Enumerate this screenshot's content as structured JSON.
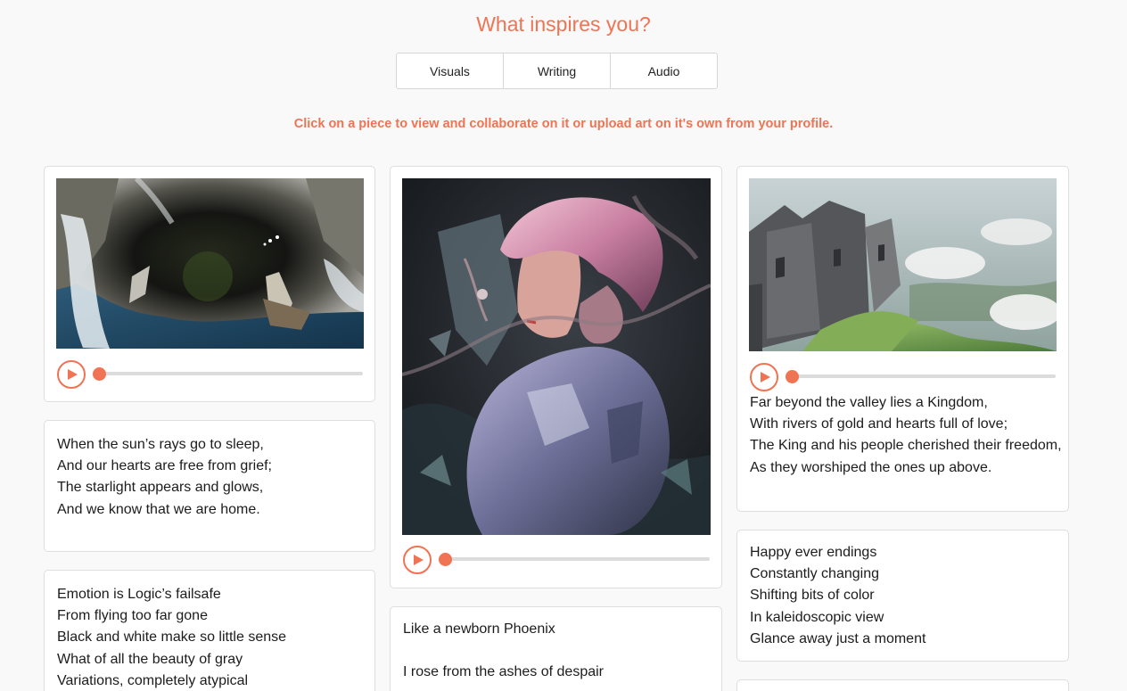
{
  "header": {
    "title": "What inspires you?",
    "hint": "Click on a piece to view and collaborate on it or upload art on it's own from your profile."
  },
  "tabs": [
    {
      "label": "Visuals"
    },
    {
      "label": "Writing"
    },
    {
      "label": "Audio"
    }
  ],
  "colors": {
    "accent": "#f07353",
    "track": "#dcdcdc",
    "card_border": "#dedede",
    "background": "#f9f9f9"
  },
  "cards": {
    "visual_1": {
      "art": "waterfall-abyss-artwork",
      "player_icon": "play-icon"
    },
    "visual_2": {
      "art": "pink-haired-android-girl-artwork",
      "player_icon": "play-icon"
    },
    "visual_3": {
      "art": "cliffside-castle-artwork",
      "player_icon": "play-icon",
      "poem": [
        "Far beyond the valley lies a Kingdom,",
        "With rivers of gold and hearts full of love;",
        "The King and his people cherished their freedom,",
        "As they worshiped the ones up above."
      ]
    },
    "poem_sleep": [
      "When the sun’s rays go to sleep,",
      "And our hearts are free from grief;",
      "The starlight appears and glows,",
      "And we know that we are home."
    ],
    "poem_emotion": [
      "Emotion is Logic’s failsafe",
      "From flying too far gone",
      "Black and white make so little sense",
      "What of all the beauty of gray",
      "Variations, completely atypical"
    ],
    "poem_phoenix": [
      "Like a newborn Phoenix",
      "",
      "I rose from the ashes of despair"
    ],
    "poem_endings": [
      "Happy ever endings",
      "Constantly changing",
      "Shifting bits of color",
      "In kaleidoscopic view",
      "Glance away just a moment"
    ]
  }
}
